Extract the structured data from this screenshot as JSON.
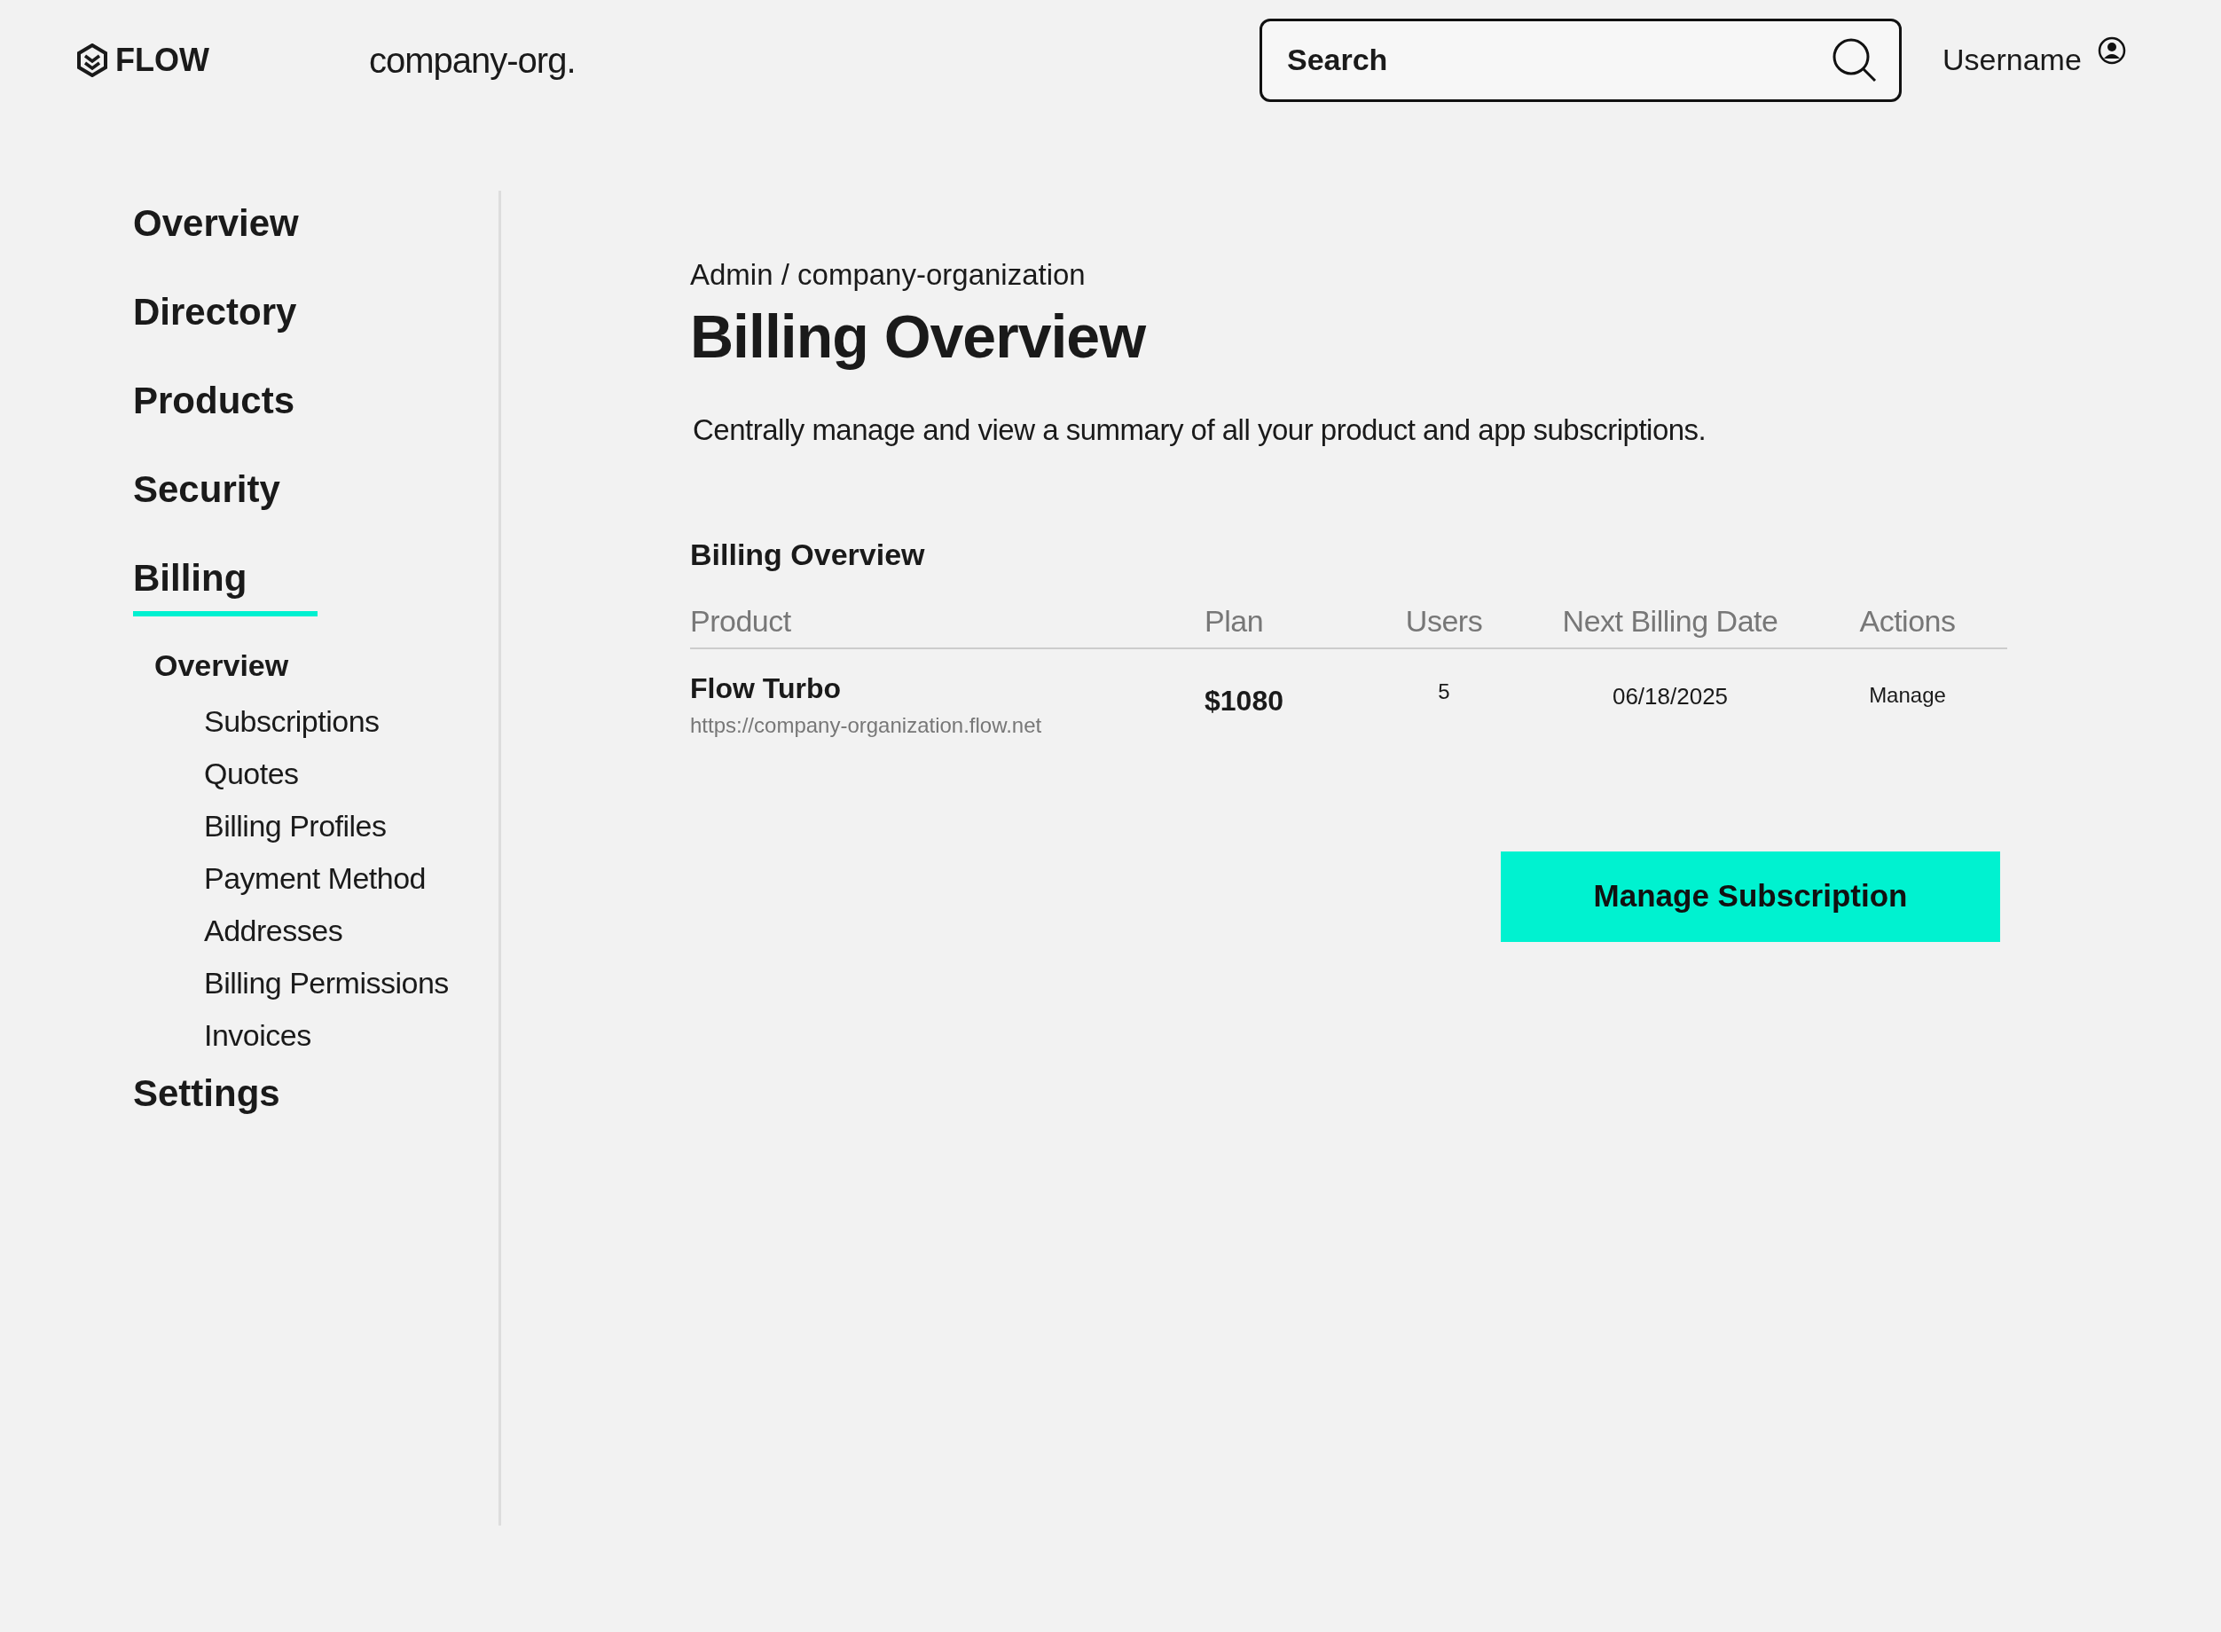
{
  "header": {
    "logo": "FLOW",
    "org": "company-org.",
    "search": {
      "placeholder": "Search"
    },
    "user": "Username"
  },
  "sidebar": {
    "items": [
      {
        "label": "Overview",
        "selected": false
      },
      {
        "label": "Directory",
        "selected": false
      },
      {
        "label": "Products",
        "selected": false
      },
      {
        "label": "Security",
        "selected": false
      },
      {
        "label": "Billing",
        "selected": true,
        "children": [
          {
            "label": "Overview",
            "selected": true,
            "children": [
              {
                "label": "Subscriptions",
                "selected": false
              },
              {
                "label": "Quotes",
                "selected": false
              },
              {
                "label": "Billing Profiles",
                "selected": false
              },
              {
                "label": "Payment Method",
                "selected": false
              },
              {
                "label": "Addresses",
                "selected": false
              },
              {
                "label": "Billing Permissions",
                "selected": false
              },
              {
                "label": "Invoices",
                "selected": false
              }
            ]
          }
        ]
      },
      {
        "label": "Settings",
        "selected": false
      }
    ]
  },
  "breadcrumb": "Admin / company-organization",
  "title": "Billing Overview",
  "description": "Centrally manage and view a summary of all your product and app subscriptions.",
  "table": {
    "title": "Billing Overview",
    "columns": [
      "Product",
      "Plan",
      "Users",
      "Next Billing Date",
      "Actions"
    ],
    "rows": [
      {
        "product": "Flow Turbo",
        "url": "https://company-organization.flow.net",
        "plan": "$1080",
        "users": "5",
        "next_billing_date": "06/18/2025",
        "action": "Manage"
      }
    ]
  },
  "button": "Manage Subscription"
}
